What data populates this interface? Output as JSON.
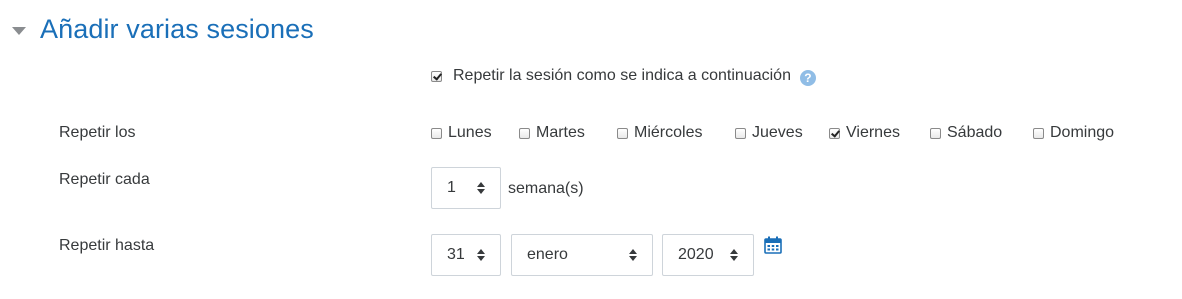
{
  "section": {
    "title": "Añadir varias sesiones"
  },
  "repeat": {
    "checked": true,
    "label": "Repetir la sesión como se indica a continuación",
    "help_glyph": "?"
  },
  "repeat_on": {
    "label": "Repetir los",
    "days": [
      {
        "label": "Lunes",
        "checked": false
      },
      {
        "label": "Martes",
        "checked": false
      },
      {
        "label": "Miércoles",
        "checked": false
      },
      {
        "label": "Jueves",
        "checked": false
      },
      {
        "label": "Viernes",
        "checked": true
      },
      {
        "label": "Sábado",
        "checked": false
      },
      {
        "label": "Domingo",
        "checked": false
      }
    ]
  },
  "repeat_every": {
    "label": "Repetir cada",
    "value": "1",
    "unit": "semana(s)"
  },
  "repeat_until": {
    "label": "Repetir hasta",
    "day": "31",
    "month": "enero",
    "year": "2020"
  },
  "colors": {
    "accent": "#1a6fb8",
    "help_icon": "#90bde6",
    "calendar_icon": "#1a6fb8",
    "text": "#373a3c"
  },
  "icons": {
    "collapse": "caret-down-icon",
    "help": "question-circle-icon",
    "calendar": "calendar-icon"
  }
}
